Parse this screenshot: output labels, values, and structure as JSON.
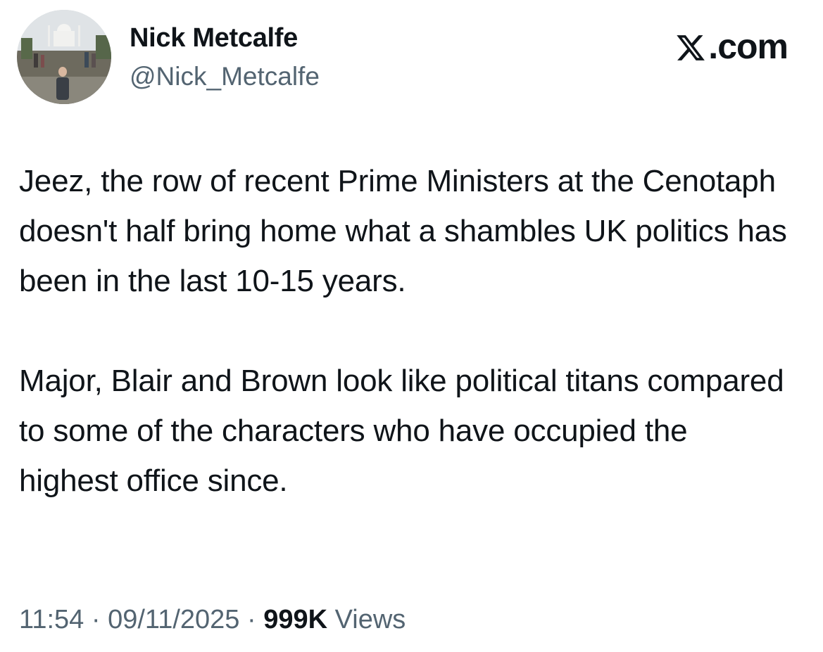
{
  "author": {
    "display_name": "Nick Metcalfe",
    "handle": "@Nick_Metcalfe"
  },
  "brand": {
    "label": ".com",
    "icon": "x-logo-icon"
  },
  "tweet": {
    "paragraphs": [
      "Jeez, the row of recent Prime Ministers at the Cenotaph doesn't half bring home what a shambles UK politics has been in the last 10-15 years.",
      "Major, Blair and Brown look like political titans compared to some of the characters who have occupied the highest office since."
    ]
  },
  "meta": {
    "time": "11:54",
    "separator": " · ",
    "date": "09/11/2025",
    "views_count": "999K",
    "views_label": " Views"
  }
}
